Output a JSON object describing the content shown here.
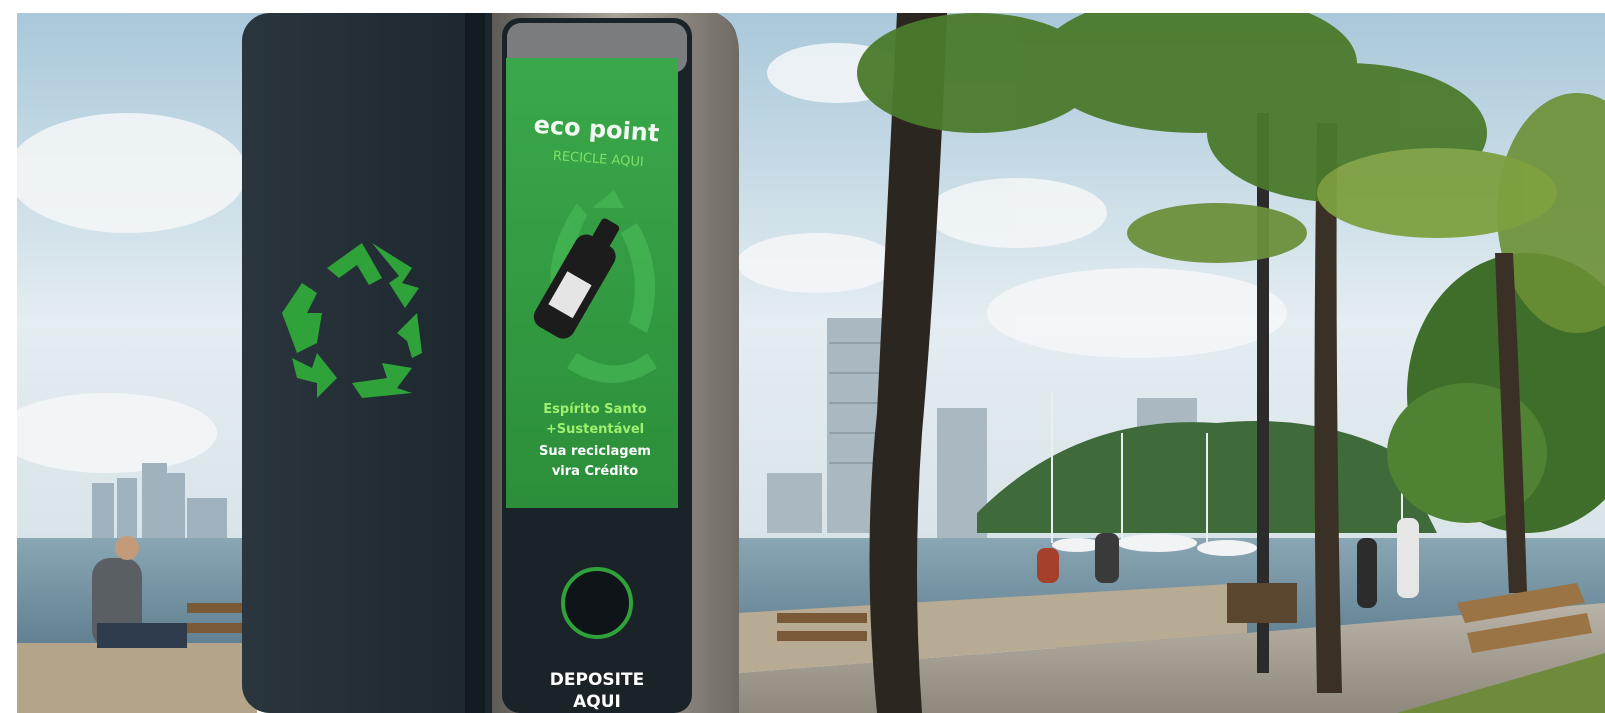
{
  "photo": {
    "subject": "Recycling kiosk on a waterfront promenade",
    "kiosk": {
      "brand": "eco point",
      "tagline": "RECICLE AQUI",
      "slogan_line1": "Espírito Santo",
      "slogan_line2": "+Sustentável",
      "message_line1": "Sua reciclagem",
      "message_line2": "vira Crédito",
      "deposit_line1": "DEPOSITE",
      "deposit_line2": "AQUI"
    },
    "colors": {
      "kiosk_body": "#1f2b33",
      "screen_green": "#2e9e3c",
      "recycle_green": "#2fa23a",
      "sky": "#cfe0ea",
      "sea": "#6f8fa0"
    }
  }
}
